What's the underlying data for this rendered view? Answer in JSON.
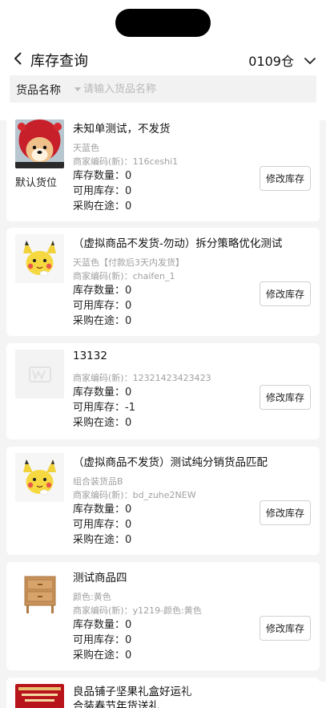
{
  "header": {
    "title": "库存查询",
    "warehouse": "0109仓"
  },
  "search": {
    "field_type": "货品名称",
    "placeholder": "请输入货品名称",
    "value": ""
  },
  "items": [
    {
      "name": "未知单测试，不发货",
      "spec": "天蓝色",
      "code": "商家编码(新)：116ceshi1",
      "location": "默认货位",
      "stock": "库存数量：0",
      "available": "可用库存：0",
      "incoming": "采购在途：0",
      "button": "修改库存",
      "image": "dog-with-red-hat-image"
    },
    {
      "name": "（虚拟商品不发货-勿动）拆分策略优化测试",
      "spec": "天蓝色【付款后3天内发货】",
      "code": "商家编码(新)：chaifen_1",
      "stock": "库存数量：0",
      "available": "可用库存：0",
      "incoming": "采购在途：0",
      "button": "修改库存",
      "image": "yellow-cartoon-mouse-image"
    },
    {
      "name": "13132",
      "code": "商家编码(新)：12321423423423",
      "stock": "库存数量：0",
      "available": "可用库存：-1",
      "incoming": "采购在途：0",
      "button": "修改库存",
      "image": "placeholder-logo-image"
    },
    {
      "name": "（虚拟商品不发货）测试纯分销货品匹配",
      "spec": "组合装货品B",
      "code": "商家编码(新)：bd_zuhe2NEW",
      "stock": "库存数量：0",
      "available": "可用库存：0",
      "incoming": "采购在途：0",
      "button": "修改库存",
      "image": "yellow-cartoon-mouse-image"
    },
    {
      "name": "测试商品四",
      "spec": "颜色:黄色",
      "code": "商家编码(新)：y1219-颜色:黄色",
      "stock": "库存数量：0",
      "available": "可用库存：0",
      "incoming": "采购在途：0",
      "button": "修改库存",
      "image": "wooden-nightstand-image"
    },
    {
      "name": "良品铺子坚果礼盒好运礼",
      "name_line2": "合装春节年货送礼",
      "image": "red-gift-box-image"
    }
  ],
  "colors": {
    "background": "#f4f4f4",
    "card": "#ffffff",
    "muted_text": "#a0a0a0",
    "button_border": "#d0d0d0"
  }
}
